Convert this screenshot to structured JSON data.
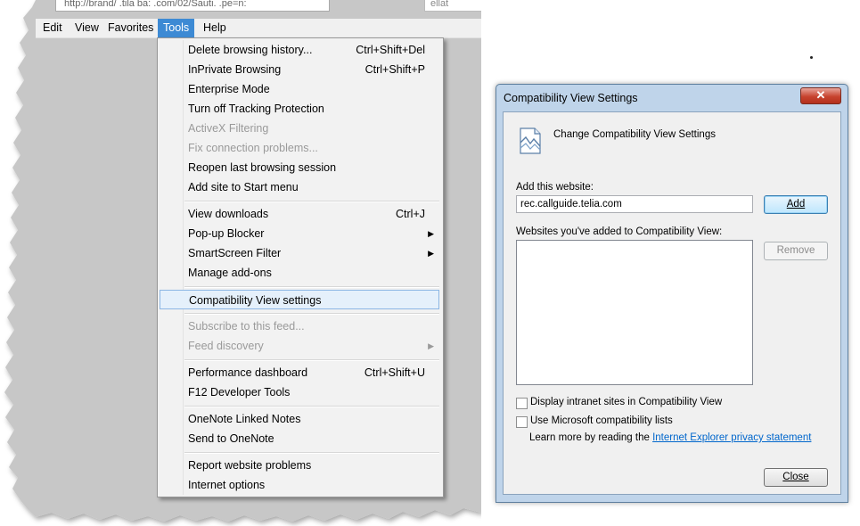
{
  "browser": {
    "address_text": "http://brand/ .tila  ba:  .com/02/Sauti.   .pe=n:",
    "right_box_text": "ellat"
  },
  "menubar": {
    "items": [
      {
        "label": "Edit"
      },
      {
        "label": "View"
      },
      {
        "label": "Favorites"
      },
      {
        "label": "Tools",
        "active": true
      },
      {
        "label": "Help"
      }
    ]
  },
  "tools_menu": {
    "items": [
      {
        "label": "Delete browsing history...",
        "shortcut": "Ctrl+Shift+Del"
      },
      {
        "label": "InPrivate Browsing",
        "shortcut": "Ctrl+Shift+P"
      },
      {
        "label": "Enterprise Mode",
        "shortcut": ""
      },
      {
        "label": "Turn off Tracking Protection",
        "shortcut": ""
      },
      {
        "label": "ActiveX Filtering",
        "shortcut": "",
        "disabled": true
      },
      {
        "label": "Fix connection problems...",
        "shortcut": "",
        "disabled": true
      },
      {
        "label": "Reopen last browsing session",
        "shortcut": ""
      },
      {
        "label": "Add site to Start menu",
        "shortcut": ""
      },
      {
        "label": "View downloads",
        "shortcut": "Ctrl+J"
      },
      {
        "label": "Pop-up Blocker",
        "submenu": true
      },
      {
        "label": "SmartScreen Filter",
        "submenu": true
      },
      {
        "label": "Manage add-ons",
        "shortcut": ""
      },
      {
        "label": "Compatibility View settings",
        "highlighted": true
      },
      {
        "label": "Subscribe to this feed...",
        "disabled": true
      },
      {
        "label": "Feed discovery",
        "disabled": true,
        "submenu": true
      },
      {
        "label": "Performance dashboard",
        "shortcut": "Ctrl+Shift+U"
      },
      {
        "label": "F12 Developer Tools",
        "shortcut": ""
      },
      {
        "label": "OneNote Linked Notes",
        "shortcut": ""
      },
      {
        "label": "Send to OneNote",
        "shortcut": ""
      },
      {
        "label": "Report website problems",
        "shortcut": ""
      },
      {
        "label": "Internet options",
        "shortcut": ""
      }
    ]
  },
  "dialog": {
    "title": "Compatibility View Settings",
    "close_glyph": "✕",
    "heading": "Change Compatibility View Settings",
    "add_label": "Add this website:",
    "site_value": "rec.callguide.telia.com",
    "add_button": "Add",
    "list_label": "Websites you've added to Compatibility View:",
    "remove_button": "Remove",
    "checkbox_intranet": "Display intranet sites in Compatibility View",
    "checkbox_ms_lists": "Use Microsoft compatibility lists",
    "learn_more_prefix": "Learn more by reading the ",
    "learn_more_link": "Internet Explorer privacy statement",
    "close_button": "Close",
    "colors": {
      "link": "#0066cc",
      "frame": "#bfd4ea"
    }
  },
  "icons": [
    "refresh-icon",
    "compat-view-icon",
    "submenu-arrow-icon",
    "dialog-close-icon"
  ]
}
